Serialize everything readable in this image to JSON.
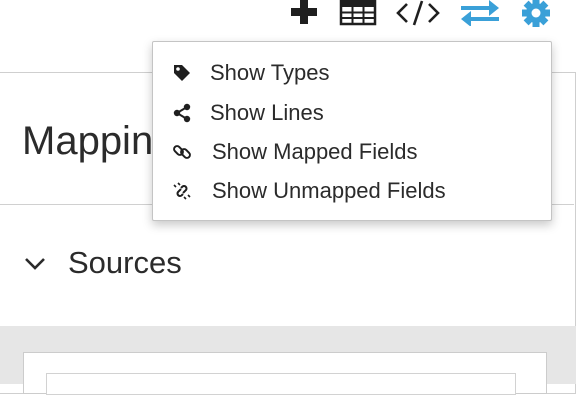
{
  "toolbar": {
    "buttons": [
      {
        "name": "add-icon"
      },
      {
        "name": "table-icon"
      },
      {
        "name": "code-icon"
      },
      {
        "name": "swap-arrows-icon",
        "color": "#3aa0d8"
      },
      {
        "name": "gear-icon",
        "color": "#3aa0d8"
      }
    ]
  },
  "panel": {
    "title": "Mapping",
    "sources_label": "Sources"
  },
  "menu": {
    "items": [
      {
        "label": "Show Types",
        "icon": "tag-icon"
      },
      {
        "label": "Show Lines",
        "icon": "share-nodes-icon"
      },
      {
        "label": "Show Mapped Fields",
        "icon": "link-icon"
      },
      {
        "label": "Show Unmapped Fields",
        "icon": "unlink-icon"
      }
    ]
  },
  "colors": {
    "accent": "#3aa0d8",
    "text": "#2b2b2b",
    "panel_gray": "#e6e6e6"
  }
}
